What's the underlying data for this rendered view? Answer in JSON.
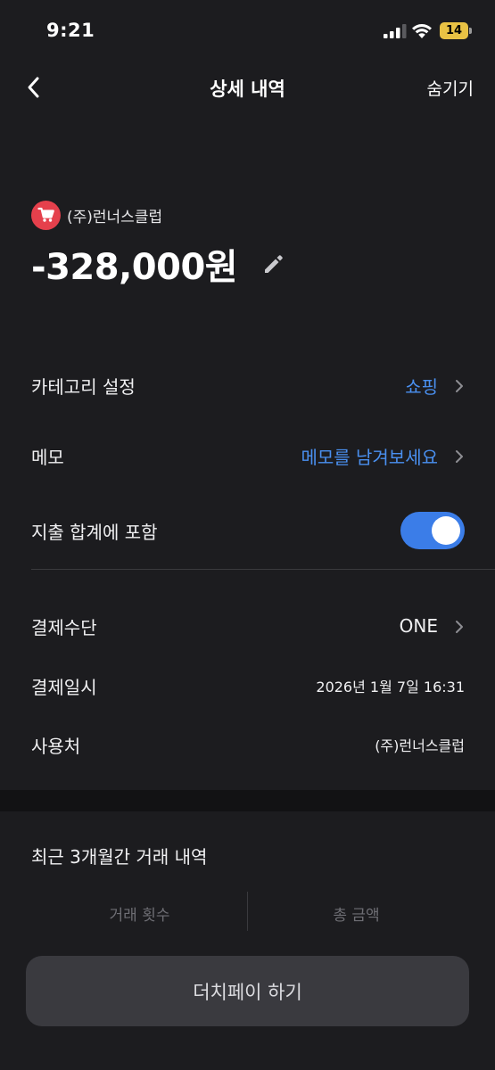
{
  "status_bar": {
    "time": "9:21",
    "battery_level": "14",
    "battery_color": "#e9c244"
  },
  "nav": {
    "back_icon": "chevron-left-icon",
    "title": "상세 내역",
    "hide_label": "숨기기"
  },
  "transaction": {
    "merchant_icon": "shopping-cart-icon",
    "merchant_icon_color": "#e5404c",
    "merchant_name": "(주)런너스클럽",
    "amount": "-328,000원",
    "edit_icon": "pencil-icon"
  },
  "settings": {
    "category_label": "카테고리 설정",
    "category_value": "쇼핑",
    "memo_label": "메모",
    "memo_placeholder": "메모를 남겨보세요",
    "include_label": "지출 합계에 포함",
    "include_enabled": true,
    "accent_color": "#3b7de8"
  },
  "details": {
    "payment_method_label": "결제수단",
    "payment_method_value": "ONE",
    "payment_date_label": "결제일시",
    "payment_date_value": "2026년 1월 7일 16:31",
    "merchant_label": "사용처",
    "merchant_value": "(주)런너스클럽"
  },
  "recent": {
    "title": "최근 3개월간 거래 내역",
    "count_label": "거래 횟수",
    "total_label": "총 금액"
  },
  "footer": {
    "dutch_pay_label": "더치페이 하기"
  }
}
